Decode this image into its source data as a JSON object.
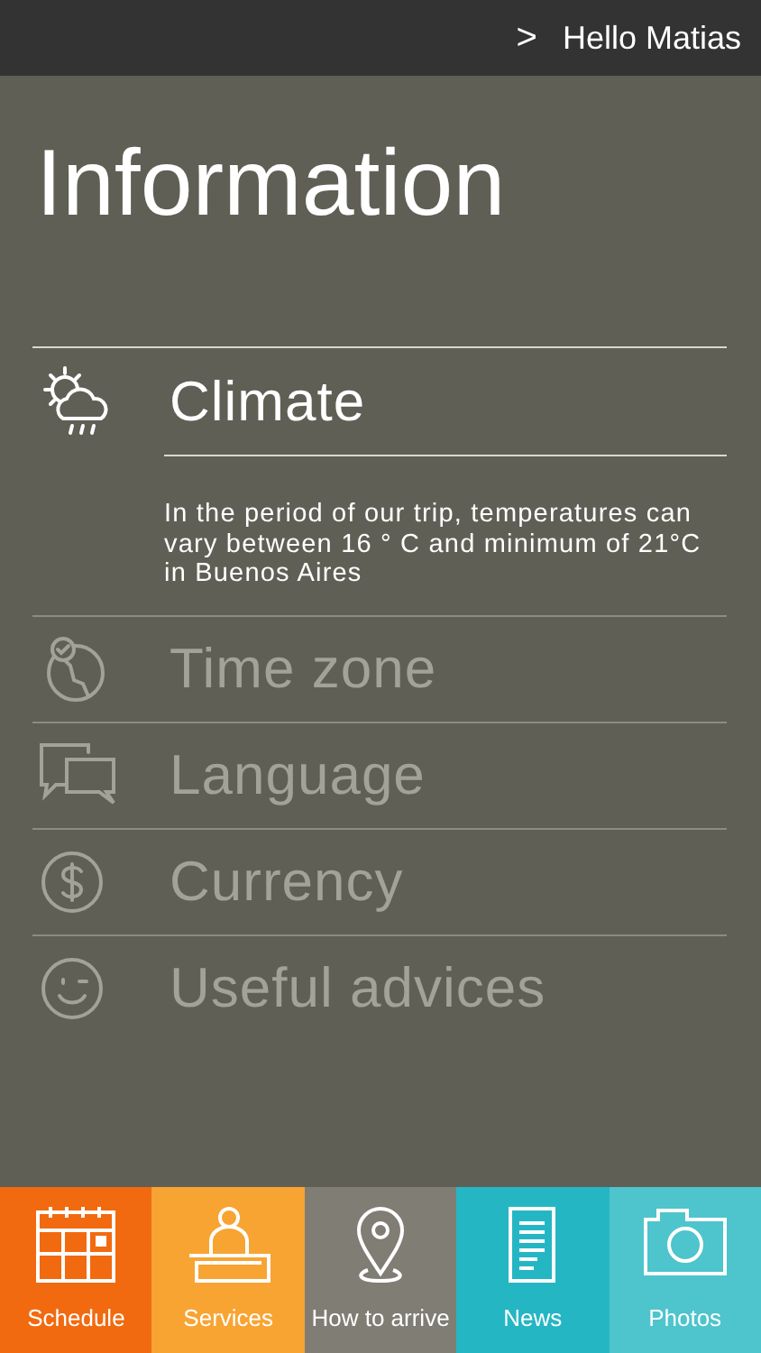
{
  "header": {
    "chevron": ">",
    "greeting": "Hello Matias"
  },
  "title": "Information",
  "sections": [
    {
      "label": "Climate",
      "expanded": true,
      "description": "In the period of our trip, temperatures can vary between 16 ° C and minimum of 21°C in Buenos Aires"
    },
    {
      "label": "Time zone",
      "expanded": false
    },
    {
      "label": "Language",
      "expanded": false
    },
    {
      "label": "Currency",
      "expanded": false
    },
    {
      "label": "Useful advices",
      "expanded": false
    }
  ],
  "tabs": [
    {
      "label": "Schedule",
      "color": "#f26a0f"
    },
    {
      "label": "Services",
      "color": "#f8a433"
    },
    {
      "label": "How to arrive",
      "color": "#7f7d74"
    },
    {
      "label": "News",
      "color": "#25b6c4"
    },
    {
      "label": "Photos",
      "color": "#4ec4cd"
    }
  ]
}
